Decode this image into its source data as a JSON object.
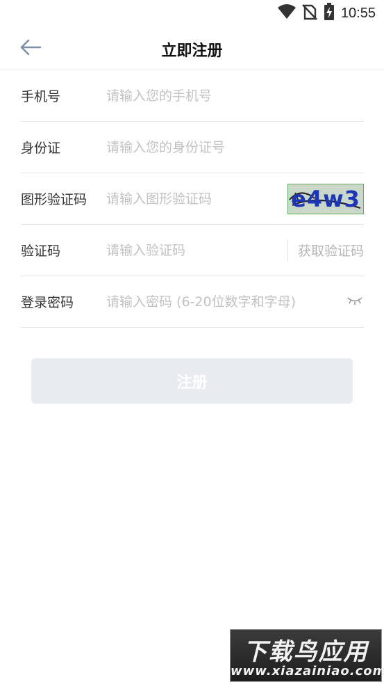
{
  "status_bar": {
    "time": "10:55",
    "icons": [
      "wifi-icon",
      "no-sim-icon",
      "battery-charging-icon"
    ]
  },
  "header": {
    "back_icon": "arrow-left-icon",
    "title": "立即注册"
  },
  "form": {
    "phone": {
      "label": "手机号",
      "placeholder": "请输入您的手机号"
    },
    "id_card": {
      "label": "身份证",
      "placeholder": "请输入您的身份证号"
    },
    "graphic_captcha": {
      "label": "图形验证码",
      "placeholder": "请输入图形验证码",
      "captcha_text": "e4w3"
    },
    "sms_code": {
      "label": "验证码",
      "placeholder": "请输入验证码",
      "get_code_label": "获取验证码"
    },
    "password": {
      "label": "登录密码",
      "placeholder": "请输入密码 (6-20位数字和字母)",
      "toggle_icon": "eye-closed-icon"
    }
  },
  "register_button": {
    "label": "注册"
  },
  "watermark": {
    "title": "下载鸟应用",
    "url": "www.xiazainiao.com"
  },
  "colors": {
    "button_bg": "#e8ebf0",
    "placeholder": "#c2c2c2",
    "back_arrow": "#7d8fa6",
    "captcha_text": "#1d35b8"
  }
}
